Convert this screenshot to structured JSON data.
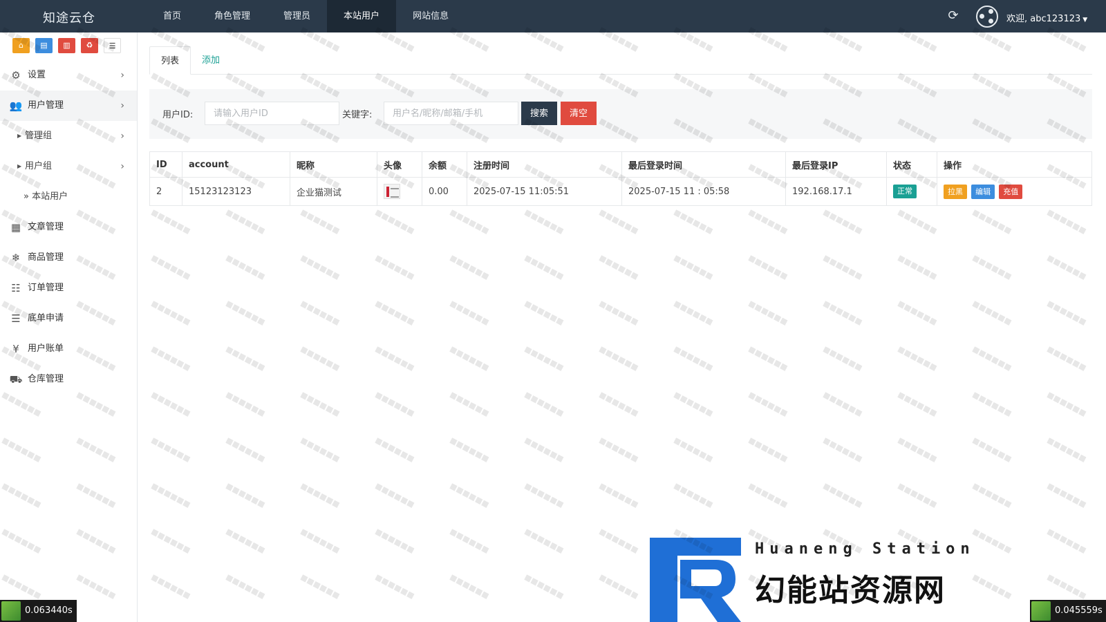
{
  "brand": "知途云仓",
  "topnav": [
    "首页",
    "角色管理",
    "管理员",
    "本站用户",
    "网站信息"
  ],
  "active_nav": 3,
  "user": {
    "welcome": "欢迎, abc123123"
  },
  "sidebar": {
    "items": [
      {
        "label": "设置",
        "icon": "gear-icon"
      },
      {
        "label": "用户管理",
        "icon": "users-icon"
      },
      {
        "label": "管理组",
        "icon": "triangle-icon"
      },
      {
        "label": "用户组",
        "icon": "triangle-icon"
      },
      {
        "label": "» 本站用户",
        "icon": ""
      },
      {
        "label": "文章管理",
        "icon": "newspaper-icon"
      },
      {
        "label": "商品管理",
        "icon": "snowflake-icon"
      },
      {
        "label": "订单管理",
        "icon": "server-icon"
      },
      {
        "label": "底单申请",
        "icon": "list-icon"
      },
      {
        "label": "用户账单",
        "icon": "yen-icon"
      },
      {
        "label": "仓库管理",
        "icon": "truck-icon"
      }
    ]
  },
  "tabs": {
    "list": "列表",
    "add": "添加"
  },
  "search": {
    "uid_label": "用户ID:",
    "uid_placeholder": "请输入用户ID",
    "kw_label": "关键字:",
    "kw_placeholder": "用户名/昵称/邮箱/手机",
    "search_btn": "搜索",
    "clear_btn": "清空"
  },
  "table": {
    "headers": [
      "ID",
      "account",
      "昵称",
      "头像",
      "余额",
      "注册时间",
      "最后登录时间",
      "最后登录IP",
      "状态",
      "操作"
    ],
    "rows": [
      {
        "id": "2",
        "account": "15123123123",
        "nickname": "企业猫测试",
        "balance": "0.00",
        "reg_time": "2025-07-15 11:05:51",
        "last_login": "2025-07-15 11 : 05:58",
        "last_ip": "192.168.17.1",
        "status": "正常",
        "ops": [
          "拉黑",
          "编辑",
          "充值"
        ]
      }
    ]
  },
  "timers": {
    "left": "0.063440s",
    "right": "0.045559s"
  },
  "logo": {
    "en": "Huaneng Station",
    "cn": "幻能站资源网"
  },
  "colors": {
    "topbar": "#2b3a4a",
    "accent": "#1aa094",
    "danger": "#e04b3f",
    "warning": "#f0a020",
    "info": "#3c8dde"
  }
}
